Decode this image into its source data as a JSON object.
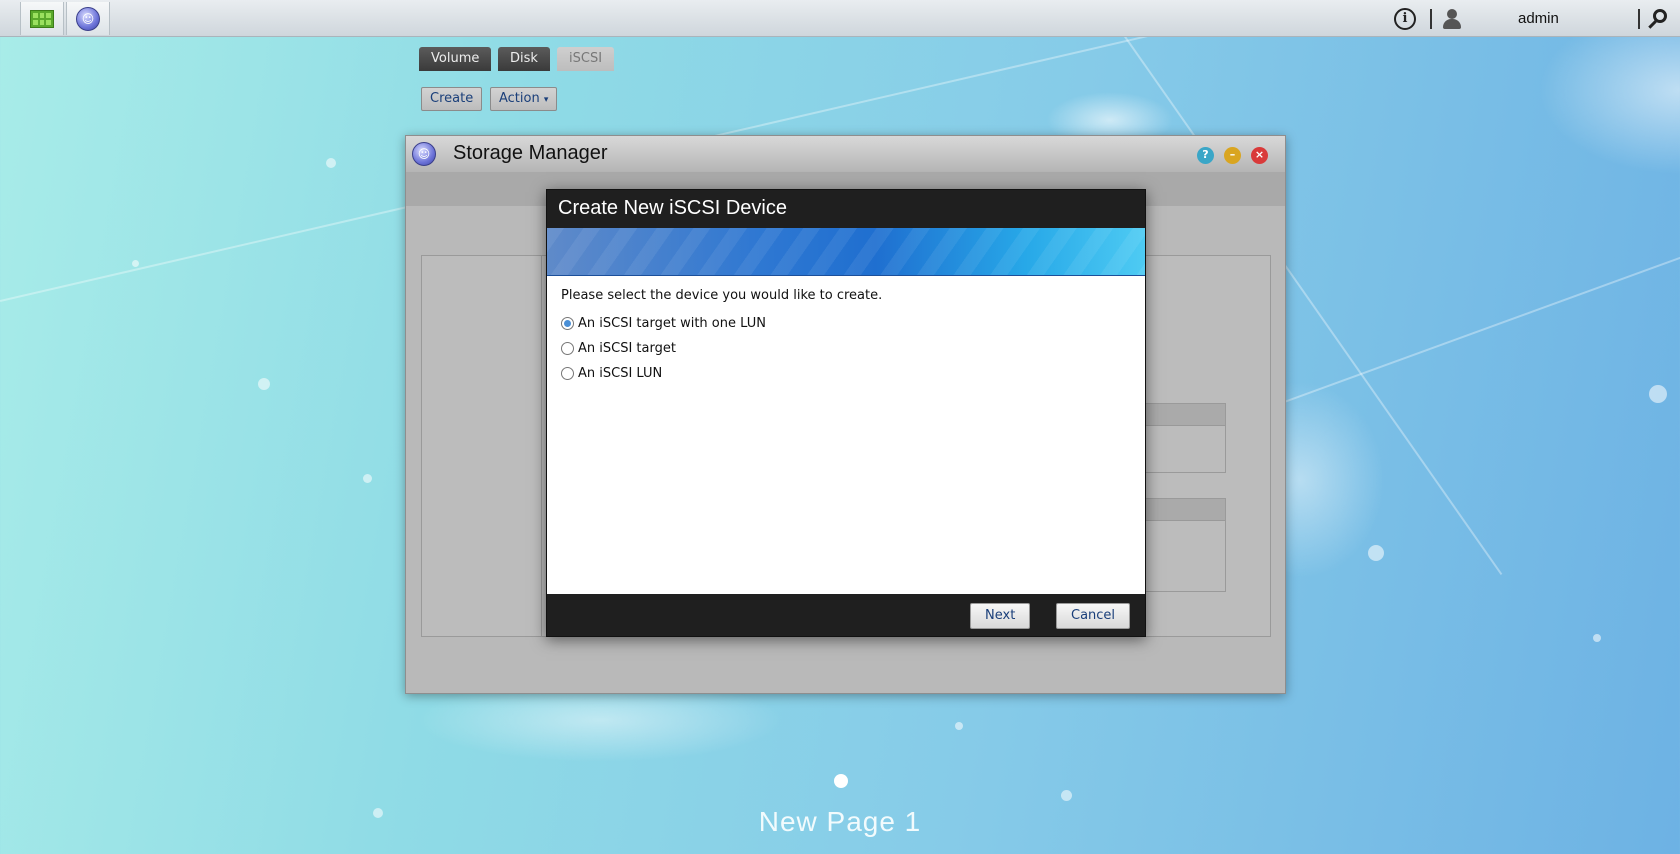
{
  "topbar": {
    "apps": [
      {
        "icon": "app-grid-icon"
      },
      {
        "icon": "storage-manager-icon"
      }
    ],
    "info_icon": "info-icon",
    "user_icon": "user-icon",
    "username": "admin",
    "search_icon": "search-icon"
  },
  "window": {
    "title": "Storage Manager",
    "controls": [
      "help-icon",
      "minimize-icon",
      "close-icon"
    ],
    "tabs": [
      {
        "label": "Volume"
      },
      {
        "label": "Disk"
      },
      {
        "label": "iSCSI"
      }
    ],
    "toolbar": {
      "create_label": "Create",
      "action_label": "Action"
    }
  },
  "dialog": {
    "title": "Create New iSCSI Device",
    "prompt": "Please select the device you would like to create.",
    "options": [
      {
        "label": "An iSCSI target with one LUN",
        "selected": true
      },
      {
        "label": "An iSCSI target",
        "selected": false
      },
      {
        "label": "An iSCSI LUN",
        "selected": false
      }
    ],
    "next_label": "Next",
    "cancel_label": "Cancel"
  },
  "desktop": {
    "page_label": "New Page 1"
  },
  "colors": {
    "dialog_header": "#1f1f1f",
    "banner_blue": "#2f78d2",
    "button_text": "#1a3f7a",
    "radio_selected": "#4a8fd6"
  }
}
